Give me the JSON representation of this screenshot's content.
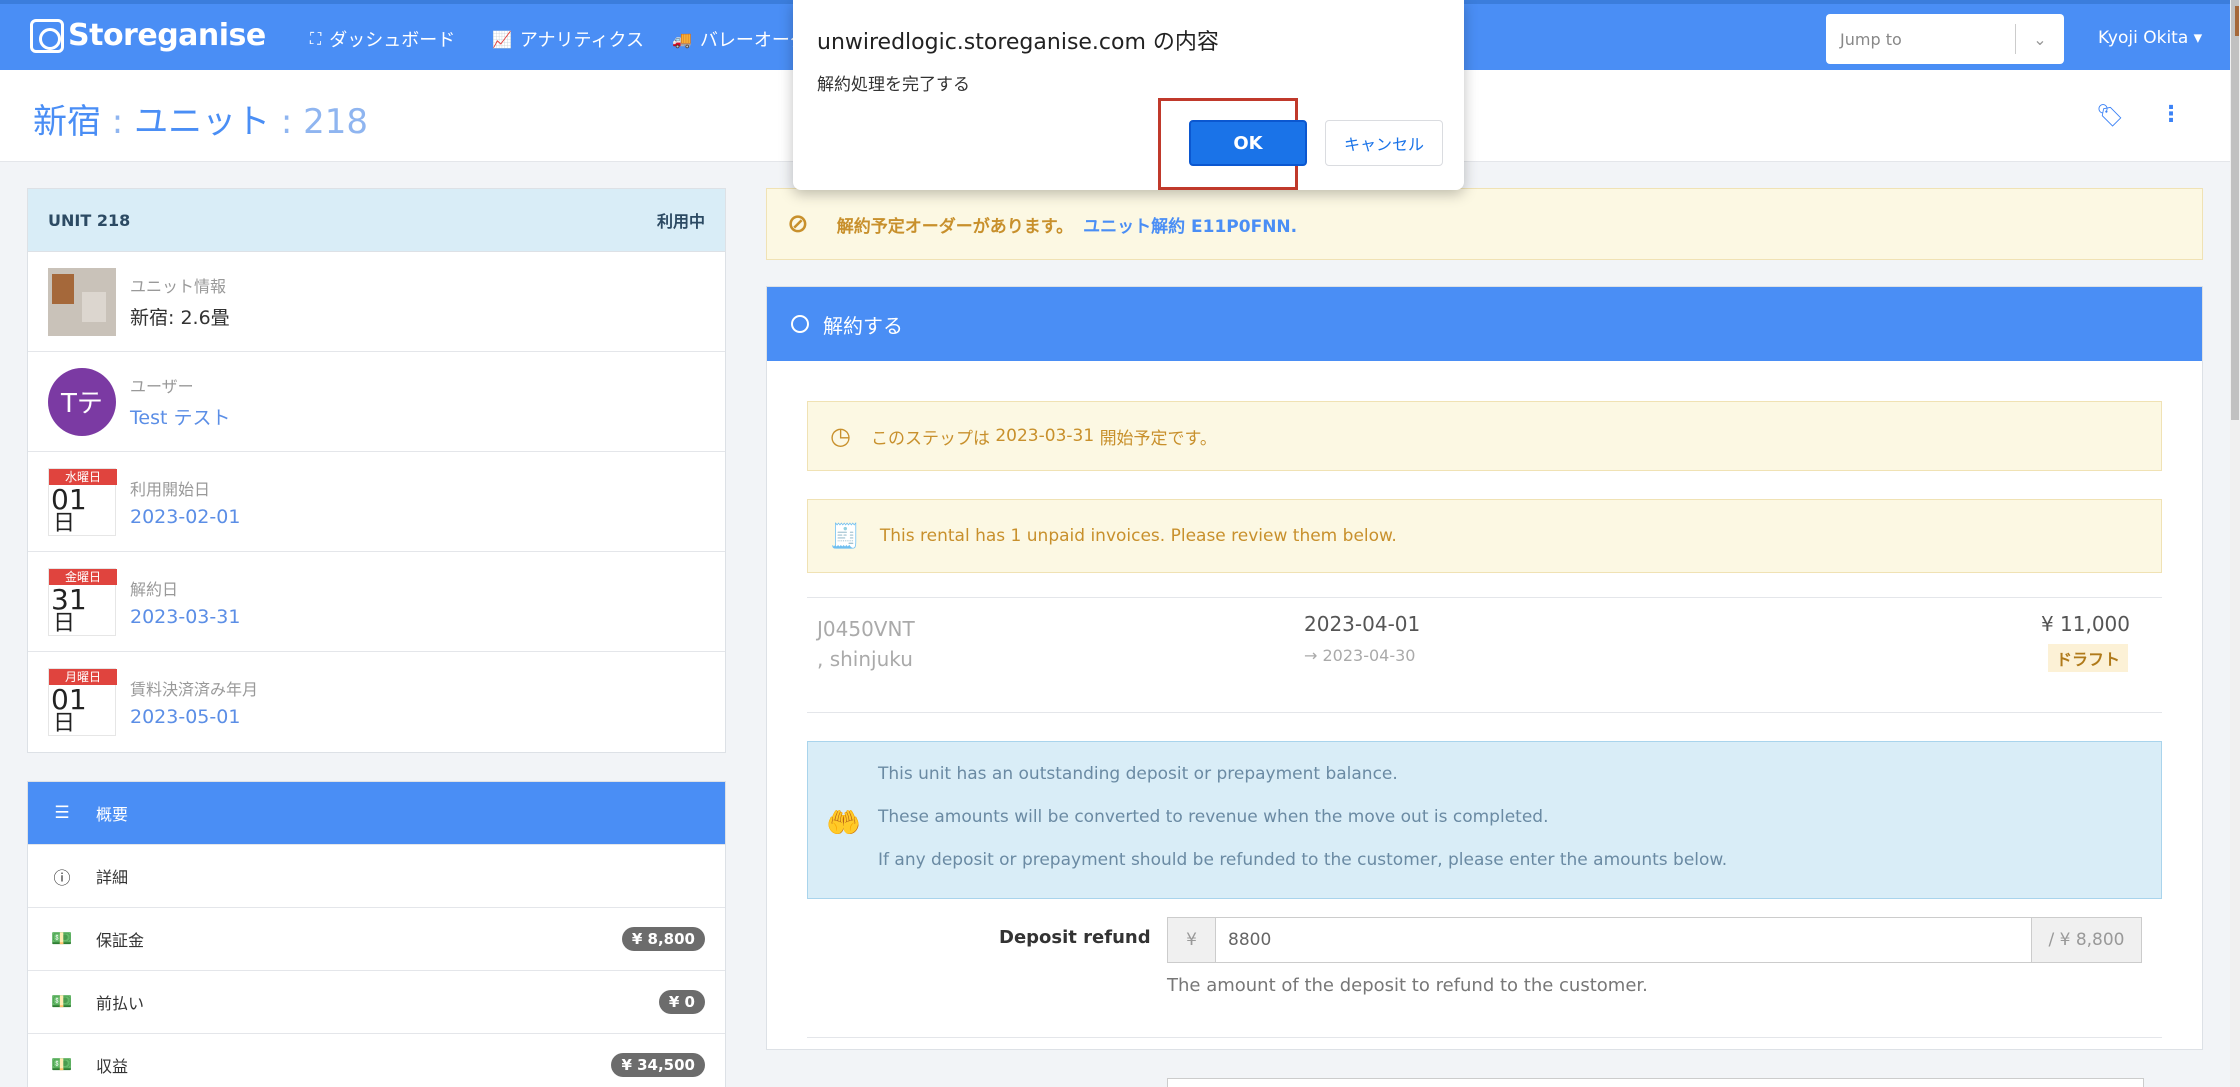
{
  "app": {
    "logo_text": "Storeganise"
  },
  "nav": {
    "dashboard": "ダッシュボード",
    "analytics": "アナリティクス",
    "valet": "バレーオーダ"
  },
  "jumpto": {
    "placeholder": "Jump to"
  },
  "user": {
    "name": "Kyoji Okita ▾"
  },
  "page": {
    "title_site": "新宿",
    "title_sep1": " : ",
    "title_unit_label": "ユニット",
    "title_sep2": " : 218"
  },
  "unit": {
    "header": "UNIT 218",
    "status": "利用中",
    "info_label": "ユニット情報",
    "info_value": "新宿: 2.6畳",
    "user_label": "ユーザー",
    "user_avatar": "Tテ",
    "user_value": "Test テスト",
    "start_label": "利用開始日",
    "start_dow": "水曜日",
    "start_day": "01",
    "start_value": "2023-02-01",
    "end_label": "解約日",
    "end_dow": "金曜日",
    "end_day": "31",
    "end_value": "2023-03-31",
    "paid_label": "賃料決済済み年月",
    "paid_dow": "月曜日",
    "paid_day": "01",
    "paid_value": "2023-05-01",
    "cal_unit": "日"
  },
  "menu": {
    "overview": "概要",
    "details": "詳細",
    "deposit": "保証金",
    "deposit_badge": "¥ 8,800",
    "prepay": "前払い",
    "prepay_badge": "¥ 0",
    "revenue": "収益",
    "revenue_badge": "¥ 34,500"
  },
  "notice": {
    "text": "解約予定オーダーがあります。",
    "link": "ユニット解約 E11P0FNN."
  },
  "panel": {
    "title": "解約する",
    "step_pre": "このステップは",
    "step_date": "2023-03-31",
    "step_post": "開始予定です。",
    "unpaid": "This rental has 1 unpaid invoices. Please review them below."
  },
  "invoice": {
    "id": "J0450VNT",
    "site": ", shinjuku",
    "date": "2023-04-01",
    "range": "→ 2023-04-30",
    "amount": "¥ 11,000",
    "status": "ドラフト"
  },
  "deposit_info": {
    "line1": "This unit has an outstanding deposit or prepayment balance.",
    "line2": "These amounts will be converted to revenue when the move out is completed.",
    "line3": "If any deposit or prepayment should be refunded to the customer, please enter the amounts below."
  },
  "refund": {
    "label": "Deposit refund",
    "prefix": "¥",
    "value": "8800",
    "max": "/ ¥ 8,800",
    "help": "The amount of the deposit to refund to the customer."
  },
  "dialog": {
    "title": "unwiredlogic.storeganise.com の内容",
    "message": "解約処理を完了する",
    "ok": "OK",
    "cancel": "キャンセル"
  },
  "colors": {
    "primary": "#4a8ef5",
    "warning_bg": "#fcf8e3",
    "info_bg": "#d9edf7",
    "highlight": "#c0392b"
  }
}
